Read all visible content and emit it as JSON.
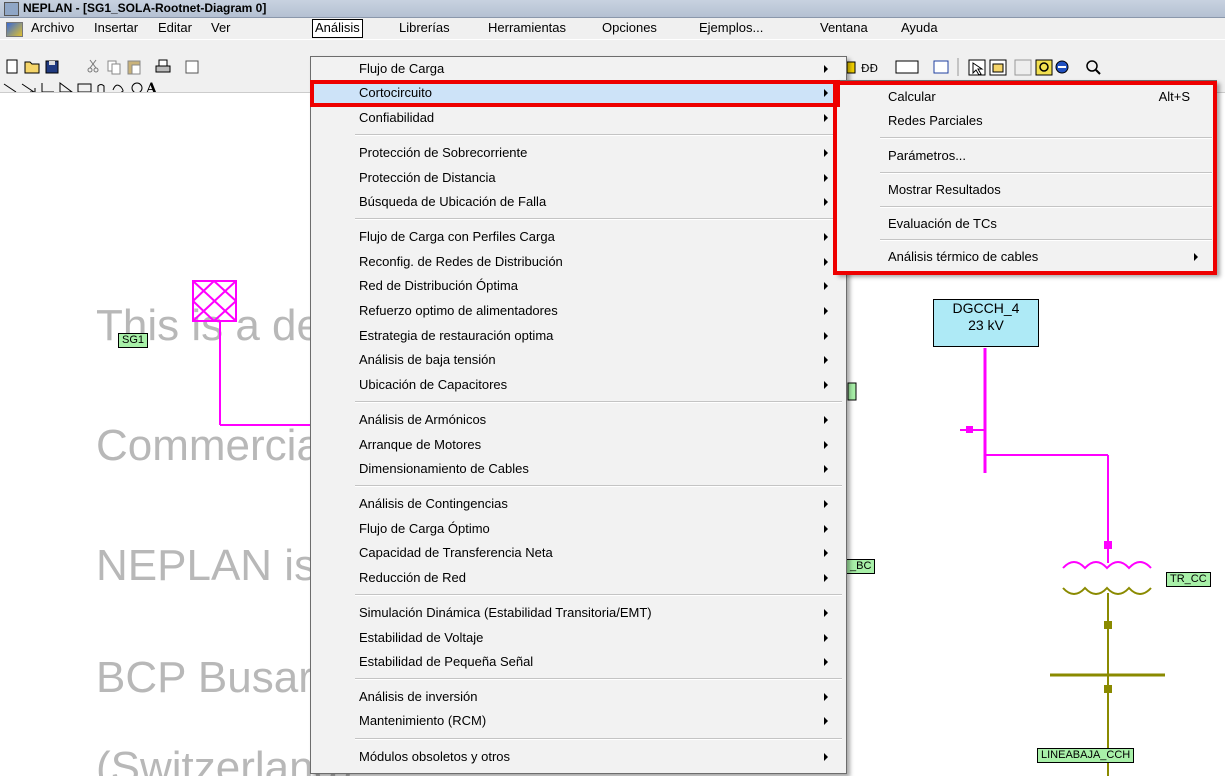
{
  "window": {
    "title": "NEPLAN - [SG1_SOLA-Rootnet-Diagram 0]"
  },
  "menubar": [
    {
      "label": "Archivo"
    },
    {
      "label": "Insertar"
    },
    {
      "label": "Editar"
    },
    {
      "label": "Ver"
    },
    {
      "label": "Análisis"
    },
    {
      "label": "Librerías"
    },
    {
      "label": "Herramientas"
    },
    {
      "label": "Opciones"
    },
    {
      "label": "Ejemplos..."
    },
    {
      "label": "Ventana"
    },
    {
      "label": "Ayuda"
    }
  ],
  "analysis_menu": [
    {
      "label": "Flujo de Carga"
    },
    {
      "label": "Cortocircuito"
    },
    {
      "label": "Confiabilidad"
    },
    {
      "label": "Protección de Sobrecorriente"
    },
    {
      "label": "Protección de Distancia"
    },
    {
      "label": "Búsqueda de Ubicación de Falla"
    },
    {
      "label": "Flujo de Carga con Perfiles Carga"
    },
    {
      "label": "Reconfig. de Redes de Distribución"
    },
    {
      "label": "Red de Distribución Óptima"
    },
    {
      "label": "Refuerzo optimo de alimentadores"
    },
    {
      "label": "Estrategia de restauración optima"
    },
    {
      "label": "Análisis de baja tensión"
    },
    {
      "label": "Ubicación de Capacitores"
    },
    {
      "label": "Análisis de Armónicos"
    },
    {
      "label": "Arranque de Motores"
    },
    {
      "label": "Dimensionamiento de Cables"
    },
    {
      "label": "Análisis de Contingencias"
    },
    {
      "label": "Flujo de Carga Óptimo"
    },
    {
      "label": "Capacidad de Transferencia Neta"
    },
    {
      "label": "Reducción de Red"
    },
    {
      "label": "Simulación Dinámica (Estabilidad Transitoria/EMT)"
    },
    {
      "label": "Estabilidad de Voltaje"
    },
    {
      "label": "Estabilidad de Pequeña Señal"
    },
    {
      "label": "Análisis de inversión"
    },
    {
      "label": "Mantenimiento (RCM)"
    },
    {
      "label": "Módulos obsoletos y otros"
    }
  ],
  "shortcircuit_submenu": [
    {
      "label": "Calcular",
      "shortcut": "Alt+S"
    },
    {
      "label": "Redes Parciales"
    },
    {
      "label": "Parámetros..."
    },
    {
      "label": "Mostrar Resultados"
    },
    {
      "label": "Evaluación de TCs"
    },
    {
      "label": "Análisis térmico de cables"
    }
  ],
  "watermark": [
    "This is a demo version!",
    "Commercial use not allowed!",
    "NEPLAN is a trademark of:",
    "BCP Busarello + Partner AG",
    "(Switzerland)"
  ],
  "diagram": {
    "sg1": "SG1",
    "bus_name": "DGCCH_4",
    "bus_voltage": "23 kV",
    "tr_label": "TR_CC",
    "bc_label": "_BC",
    "line_label": "LINEABAJA_CCH"
  },
  "colors": {
    "highlight": "#ee0000",
    "network_magenta": "#ff00ff",
    "network_olive": "#8a8a00",
    "label_green": "#a8f0a8",
    "bus_cyan": "#aeeaf6"
  },
  "icons": [
    "new-icon",
    "open-icon",
    "save-icon",
    "cut-icon",
    "copy-icon",
    "paste-icon",
    "print-icon",
    "select-arrow-icon",
    "properties-icon",
    "zoom-icon",
    "line-tool-icon",
    "rectangle-tool-icon",
    "circle-tool-icon",
    "text-tool-icon",
    "chevron-right-icon"
  ]
}
